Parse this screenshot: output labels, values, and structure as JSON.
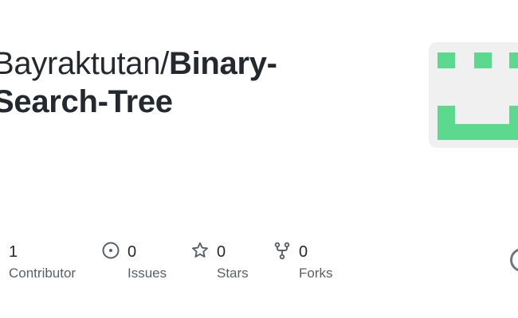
{
  "repo": {
    "owner_segment": "Bayraktutan/",
    "name_line1": "Binary-",
    "name_line2": "Search-Tree"
  },
  "stats": {
    "contributors": {
      "value": "1",
      "label": "Contributor"
    },
    "issues": {
      "value": "0",
      "label": "Issues",
      "icon": "issue-opened-icon"
    },
    "stars": {
      "value": "0",
      "label": "Stars",
      "icon": "star-icon"
    },
    "forks": {
      "value": "0",
      "label": "Forks",
      "icon": "repo-forked-icon"
    }
  },
  "colors": {
    "identicon": "#5bd98e",
    "identicon_bg": "#f0f0f0",
    "text": "#24292f",
    "muted": "#57606a"
  }
}
